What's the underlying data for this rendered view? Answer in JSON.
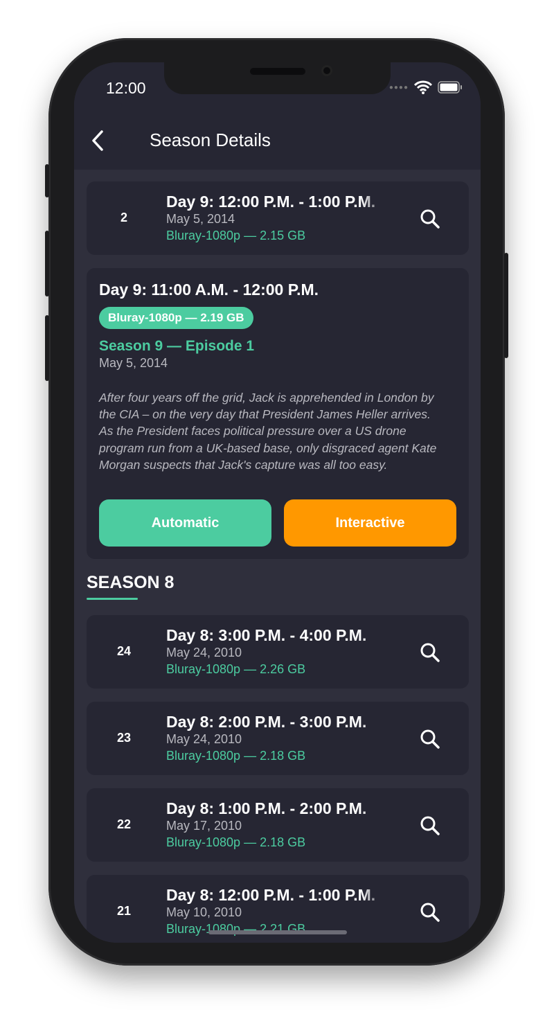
{
  "status_bar": {
    "time": "12:00"
  },
  "header": {
    "title": "Season Details",
    "back_icon": "chevron-left-icon"
  },
  "colors": {
    "accent": "#4ccca0",
    "interactive": "#ff9800",
    "card": "#262633",
    "background": "#2f2f3c"
  },
  "top_episode": {
    "number": "2",
    "title": "Day 9: 12:00 P.M. - 1:00 P.M.",
    "date": "May 5, 2014",
    "quality": "Bluray-1080p — 2.15 GB"
  },
  "expanded_episode": {
    "title": "Day 9: 11:00 A.M. - 12:00 P.M.",
    "quality": "Bluray-1080p — 2.19 GB",
    "season_episode": "Season 9 — Episode 1",
    "date": "May 5, 2014",
    "overview": "After four years off the grid, Jack is apprehended in London by the CIA – on the very day that President James Heller arrives. As the President faces political pressure over a US drone program run from a UK-based base, only disgraced agent Kate Morgan suspects that Jack's capture was all too easy.",
    "automatic_label": "Automatic",
    "interactive_label": "Interactive"
  },
  "season_8": {
    "heading": "SEASON 8",
    "episodes": [
      {
        "number": "24",
        "title": "Day 8: 3:00 P.M. - 4:00 P.M.",
        "date": "May 24, 2010",
        "quality": "Bluray-1080p — 2.26 GB"
      },
      {
        "number": "23",
        "title": "Day 8: 2:00 P.M. - 3:00 P.M.",
        "date": "May 24, 2010",
        "quality": "Bluray-1080p — 2.18 GB"
      },
      {
        "number": "22",
        "title": "Day 8: 1:00 P.M. - 2:00 P.M.",
        "date": "May 17, 2010",
        "quality": "Bluray-1080p — 2.18 GB"
      },
      {
        "number": "21",
        "title": "Day 8: 12:00 P.M. - 1:00 P.M.",
        "date": "May 10, 2010",
        "quality": "Bluray-1080p — 2.21 GB"
      }
    ]
  }
}
